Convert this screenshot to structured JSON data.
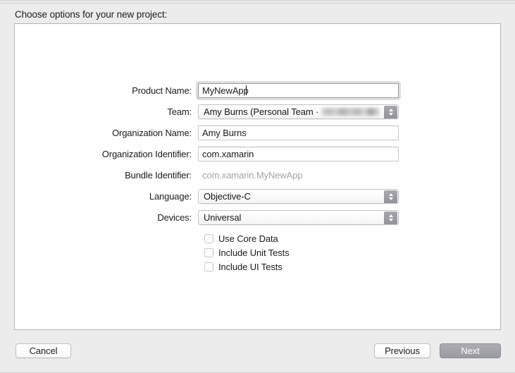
{
  "window": {
    "heading": "Choose options for your new project:"
  },
  "form": {
    "rows": [
      {
        "label": "Product Name:",
        "type": "text",
        "value": "MyNewApp",
        "focused": true
      },
      {
        "label": "Team:",
        "type": "popup",
        "value": "Amy Burns (Personal Team ·",
        "redacted": true
      },
      {
        "label": "Organization Name:",
        "type": "text",
        "value": "Amy Burns",
        "focused": false
      },
      {
        "label": "Organization Identifier:",
        "type": "text",
        "value": "com.xamarin",
        "focused": false
      },
      {
        "label": "Bundle Identifier:",
        "type": "readonly",
        "value": "com.xamarin.MyNewApp"
      },
      {
        "label": "Language:",
        "type": "popup",
        "value": "Objective-C"
      },
      {
        "label": "Devices:",
        "type": "popup",
        "value": "Universal"
      }
    ],
    "checkboxes": [
      {
        "label": "Use Core Data",
        "checked": false
      },
      {
        "label": "Include Unit Tests",
        "checked": false
      },
      {
        "label": "Include UI Tests",
        "checked": false
      }
    ]
  },
  "buttons": {
    "cancel": "Cancel",
    "previous": "Previous",
    "next": "Next"
  },
  "colors": {
    "background": "#ececec",
    "panel": "#ffffff",
    "panel_border": "#b4b4b4",
    "text": "#1b1b1b",
    "readonly_text": "#a3a3a3",
    "stepper": "#9a9aa1",
    "next_button": "#9a9aa1"
  }
}
